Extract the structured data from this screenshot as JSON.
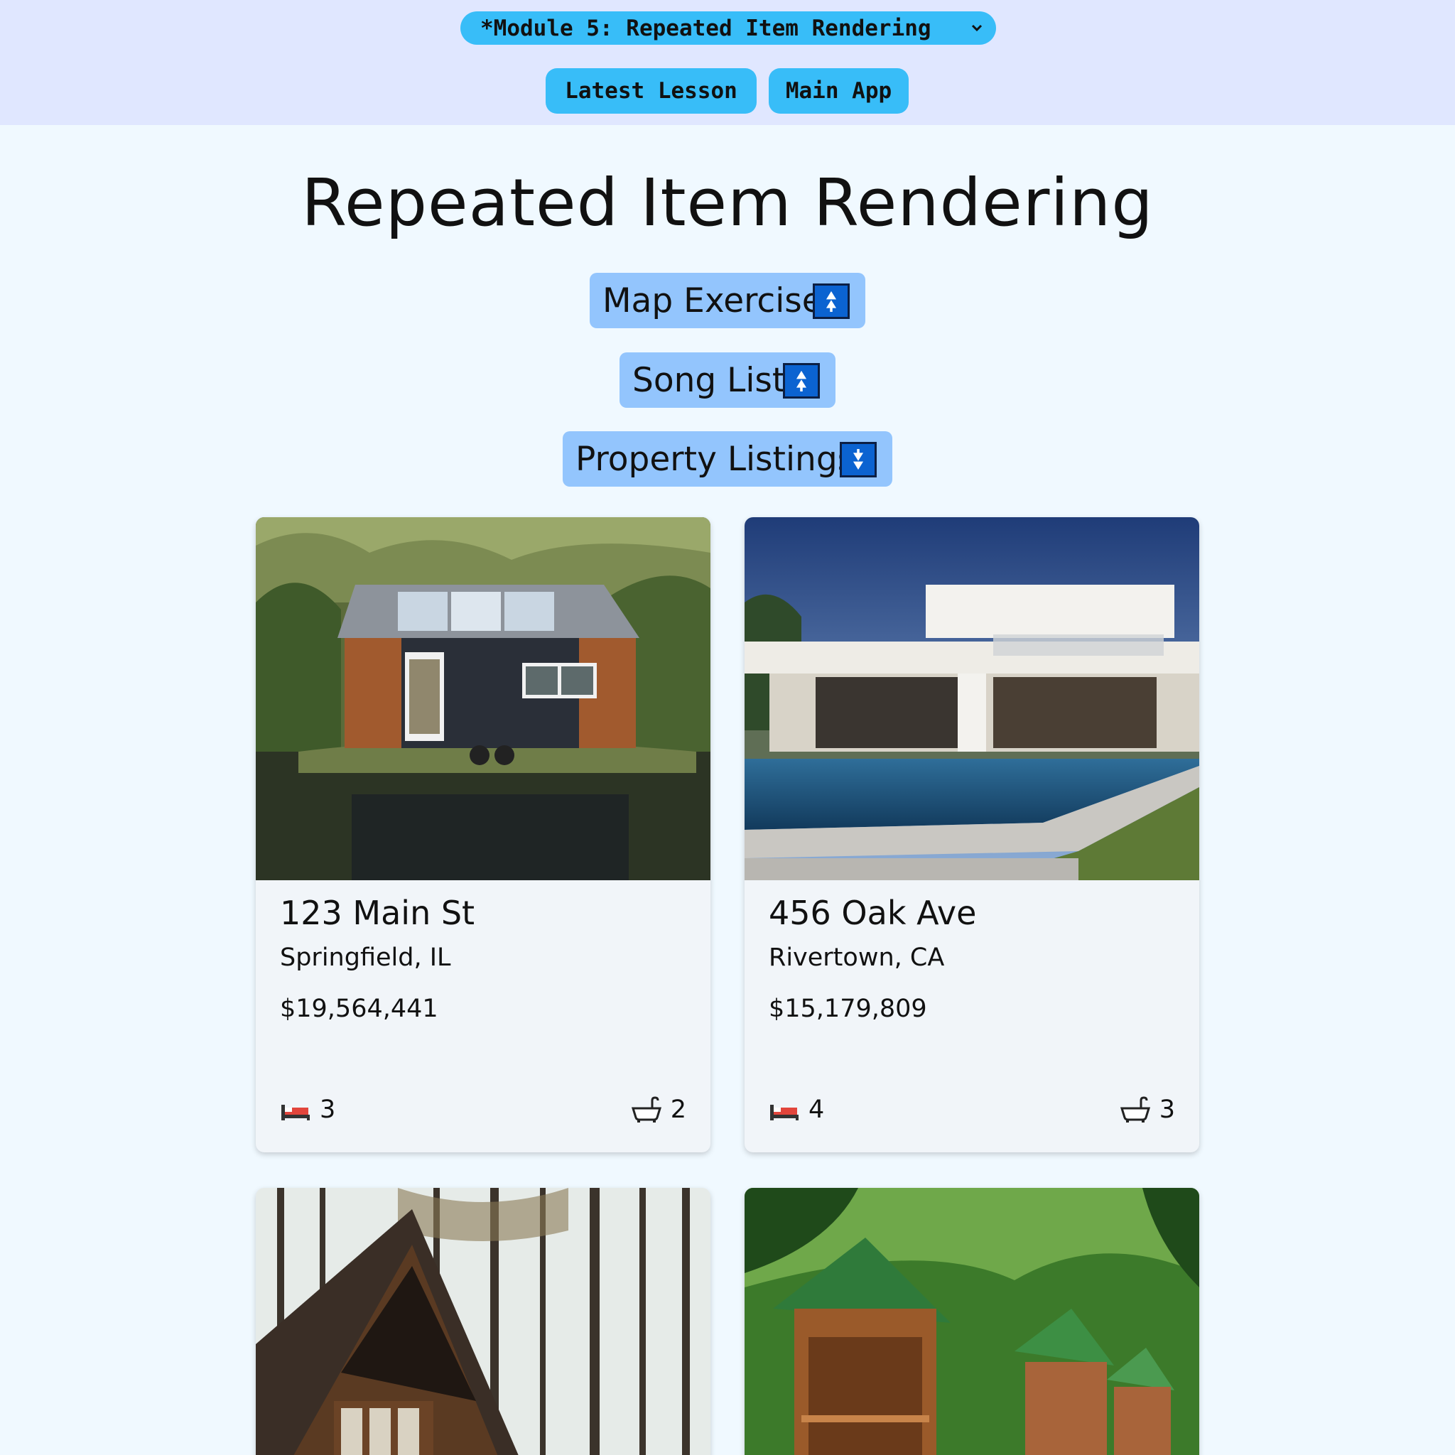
{
  "header": {
    "module_select": "*Module 5: Repeated Item Rendering",
    "latest_lesson": "Latest Lesson",
    "main_app": "Main App"
  },
  "page": {
    "title": "Repeated Item Rendering"
  },
  "sections": [
    {
      "label": "Map Exercise",
      "state": "collapsed",
      "icon": "up-arrows-icon"
    },
    {
      "label": "Song List",
      "state": "collapsed",
      "icon": "up-arrows-icon"
    },
    {
      "label": "Property Listings",
      "state": "expanded",
      "icon": "down-arrows-icon"
    }
  ],
  "listings": [
    {
      "address": "123 Main St",
      "city": "Springfield, IL",
      "price": "$19,564,441",
      "beds": "3",
      "baths": "2",
      "image": "tiny house by a lake"
    },
    {
      "address": "456 Oak Ave",
      "city": "Rivertown, CA",
      "price": "$15,179,809",
      "beds": "4",
      "baths": "3",
      "image": "modern white house with pool"
    },
    {
      "image": "a-frame wooden cabin in pine forest"
    },
    {
      "image": "log cabins with green roofs"
    }
  ],
  "colors": {
    "topbar_bg": "#e0e7ff",
    "page_bg": "#f0f9ff",
    "nav_button": "#38bdf8",
    "toggle_bg": "#93c5fd",
    "toggle_icon": "#0b63d1",
    "card_bg": "#f1f5f9"
  }
}
